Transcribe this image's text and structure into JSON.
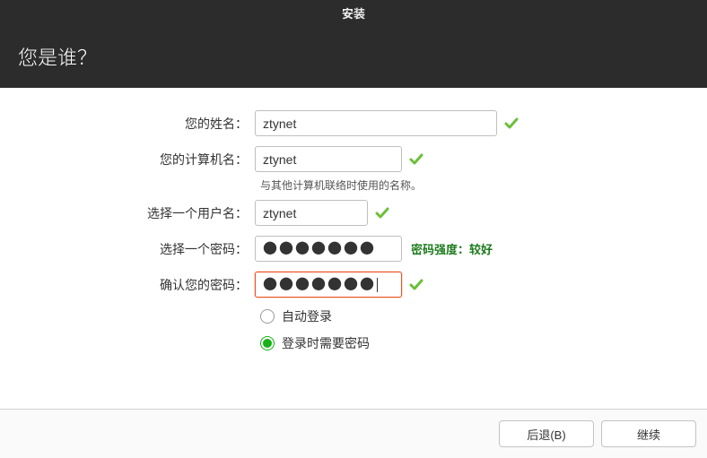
{
  "window": {
    "title": "安装"
  },
  "header": {
    "question": "您是谁？"
  },
  "fields": {
    "name": {
      "label": "您的姓名：",
      "value": "ztynet"
    },
    "computer": {
      "label": "您的计算机名：",
      "value": "ztynet",
      "hint": "与其他计算机联络时使用的名称。"
    },
    "username": {
      "label": "选择一个用户名：",
      "value": "ztynet"
    },
    "password": {
      "label": "选择一个密码：",
      "masked": "●●●●●●●",
      "strength": "密码强度：较好"
    },
    "confirm": {
      "label": "确认您的密码：",
      "masked": "●●●●●●●"
    }
  },
  "login_options": {
    "auto": "自动登录",
    "require_pw": "登录时需要密码"
  },
  "buttons": {
    "back": "后退(B)",
    "continue": "继续"
  }
}
